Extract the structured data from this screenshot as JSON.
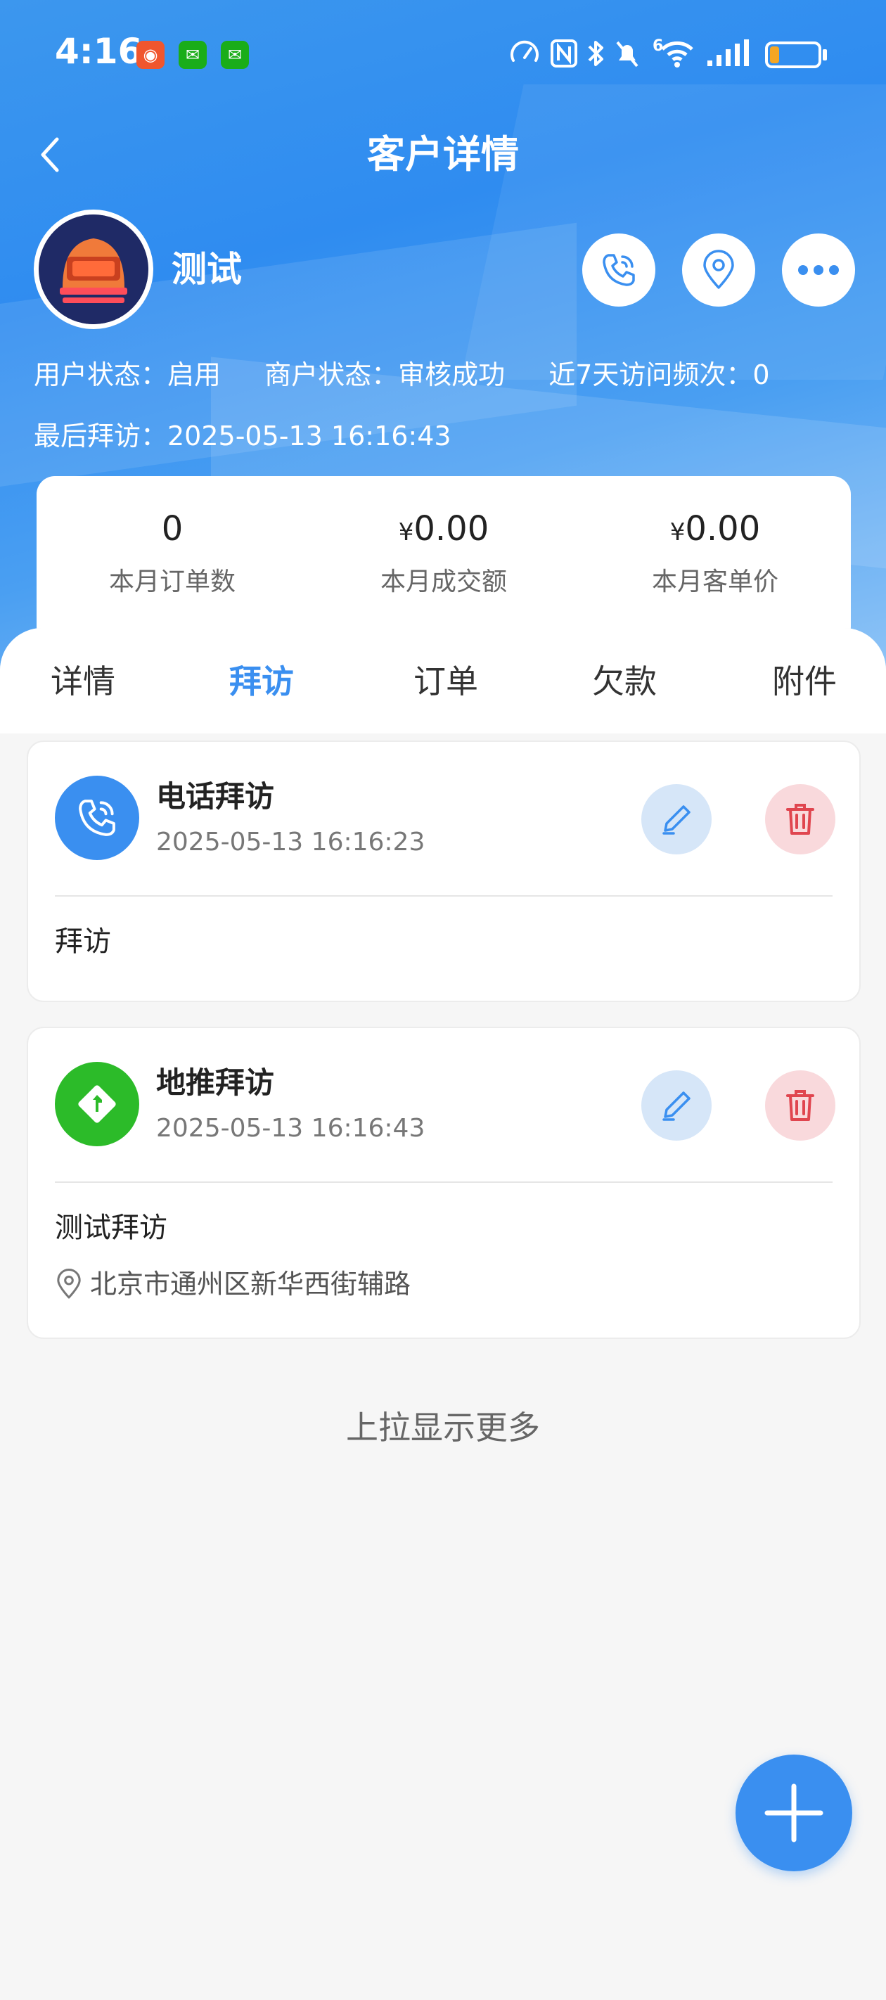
{
  "status_bar": {
    "time": "4:16",
    "network": "6",
    "battery_level": 0.2
  },
  "header": {
    "title": "客户详情"
  },
  "customer": {
    "name": "测试",
    "user_status": "用户状态：启用",
    "merchant_status": "商户状态：审核成功",
    "visit_frequency": "近7天访问频次：0",
    "last_visit": "最后拜访：2025-05-13 16:16:43"
  },
  "stats": [
    {
      "currency": "",
      "value": "0",
      "label": "本月订单数"
    },
    {
      "currency": "¥",
      "value": "0.00",
      "label": "本月成交额"
    },
    {
      "currency": "¥",
      "value": "0.00",
      "label": "本月客单价"
    }
  ],
  "tabs": [
    {
      "label": "详情",
      "active": false
    },
    {
      "label": "拜访",
      "active": true
    },
    {
      "label": "订单",
      "active": false
    },
    {
      "label": "欠款",
      "active": false
    },
    {
      "label": "附件",
      "active": false
    }
  ],
  "visits": [
    {
      "type": "电话拜访",
      "time": "2025-05-13 16:16:23",
      "note": "拜访",
      "address": "",
      "icon": "phone-icon",
      "icon_color": "#3a8ff0"
    },
    {
      "type": "地推拜访",
      "time": "2025-05-13 16:16:43",
      "note": "测试拜访",
      "address": "北京市通州区新华西街辅路",
      "icon": "route-icon",
      "icon_color": "#2cbb29"
    }
  ],
  "load_more": "上拉显示更多",
  "colors": {
    "accent": "#3a8ff0",
    "edit_bg": "#d6e6f8",
    "delete_bg": "#f9d9dc",
    "delete_icon": "#e0454f"
  }
}
